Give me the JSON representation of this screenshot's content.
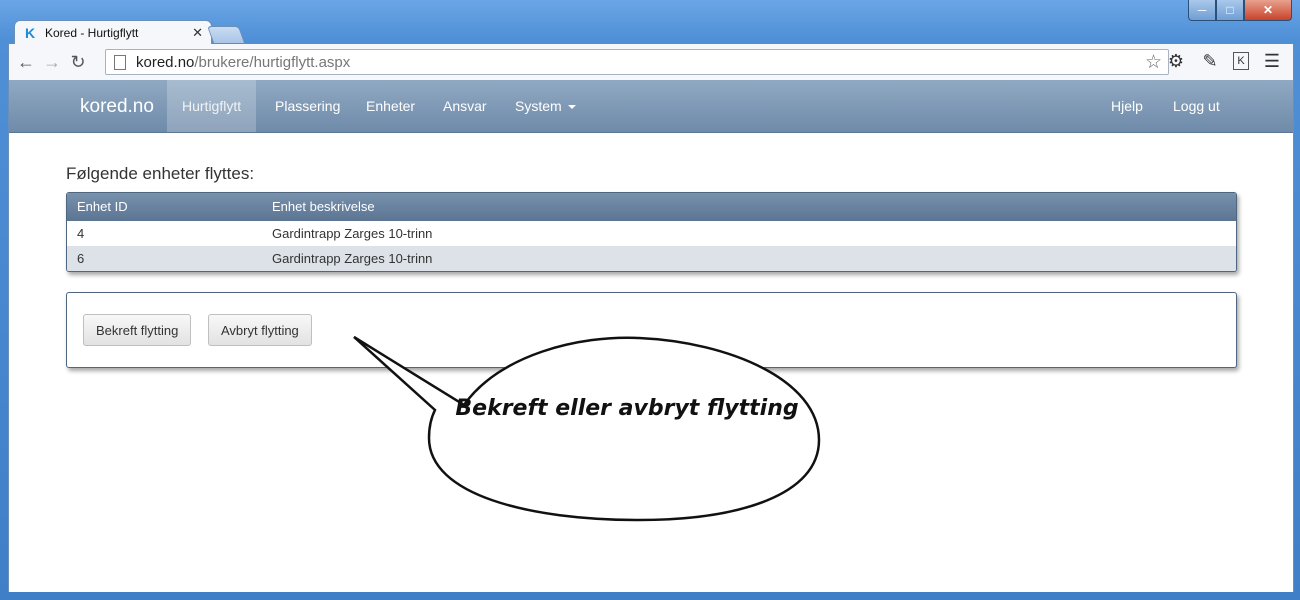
{
  "browser": {
    "tab_title": "Kored - Hurtigflytt",
    "tab_favicon": "K",
    "url_host": "kored.no",
    "url_path": "/brukere/hurtigflytt.aspx",
    "ext_label": "K"
  },
  "navbar": {
    "brand": "kored.no",
    "items": [
      "Hurtigflytt",
      "Plassering",
      "Enheter",
      "Ansvar",
      "System"
    ],
    "right_items": [
      "Hjelp",
      "Logg ut"
    ]
  },
  "main": {
    "heading": "Følgende enheter flyttes:",
    "table": {
      "headers": [
        "Enhet ID",
        "Enhet beskrivelse"
      ],
      "rows": [
        [
          "4",
          "Gardintrapp Zarges 10-trinn"
        ],
        [
          "6",
          "Gardintrapp Zarges 10-trinn"
        ]
      ]
    },
    "buttons": {
      "confirm": "Bekreft flytting",
      "cancel": "Avbryt flytting"
    }
  },
  "callout": {
    "text": "Bekreft eller avbryt flytting"
  }
}
